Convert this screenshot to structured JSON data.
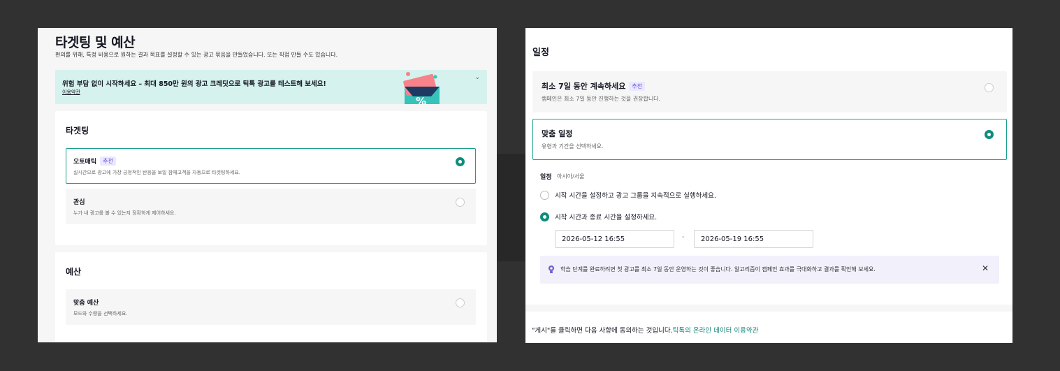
{
  "left": {
    "title": "타겟팅 및 예산",
    "subtitle": "편의를 위해, 특정 비용으로 원하는 결과 목표를 설정할 수 있는 광고 묶음을 만들었습니다. 또는 직접 만들 수도 있습니다.",
    "banner": {
      "text": "위험 부담 없이 시작하세요 – 최대 850만 원의 광고 크레딧으로 틱톡 광고를 테스트해 보세요!",
      "link": "이용약관",
      "art_glyph": "%"
    },
    "targeting": {
      "title": "타겟팅",
      "options": [
        {
          "title": "오토매틱",
          "badge": "추천",
          "desc": "실시간으로 광고에 가장 긍정적인 반응을 보일 잠재고객을 자동으로 타겟팅하세요.",
          "selected": true
        },
        {
          "title": "관심",
          "badge": "",
          "desc": "누가 내 광고를 볼 수 있는지 정확하게 제어하세요.",
          "selected": false
        }
      ]
    },
    "budget": {
      "title": "예산",
      "options": [
        {
          "title": "맞춤 예산",
          "desc": "모드와 수량을 선택하세요.",
          "selected": false
        }
      ]
    }
  },
  "right": {
    "title": "일정",
    "options": [
      {
        "title": "최소 7일 동안 계속하세요",
        "badge": "추천",
        "desc": "캠페인은 최소 7일 동안 진행하는 것을 권장합니다.",
        "selected": false
      },
      {
        "title": "맞춤 일정",
        "badge": "",
        "desc": "유형과 기간을 선택하세요.",
        "selected": true
      }
    ],
    "schedule": {
      "label": "일정",
      "timezone": "아시아/서울",
      "choices": [
        {
          "label": "시작 시간을 설정하고 광고 그룹을 지속적으로 실행하세요.",
          "selected": false
        },
        {
          "label": "시작 시간과 종료 시간을 설정하세요.",
          "selected": true
        }
      ],
      "start": "2026-05-12 16:55",
      "separator": "-",
      "end": "2026-05-19 16:55"
    },
    "tip": "학습 단계를 완료하려면 첫 광고를 최소 7일 동안 운영하는 것이 좋습니다. 알고리즘이 캠페인 효과를 극대화하고 결과를 확인해 보세요.",
    "consent_prefix": "\"게시\"를 클릭하면 다음 사항에 동의하는 것입니다.",
    "consent_link": "틱톡의 온라인 데이터 이용약관"
  },
  "colors": {
    "accent": "#0e8d7d",
    "banner_bg": "#d5f2ee",
    "badge_bg": "#ebe8ff",
    "badge_text": "#5a4fcf",
    "tip_bg": "#f2f0fb"
  },
  "icons": [
    "chevron-down-icon",
    "lightbulb-icon",
    "close-icon"
  ]
}
